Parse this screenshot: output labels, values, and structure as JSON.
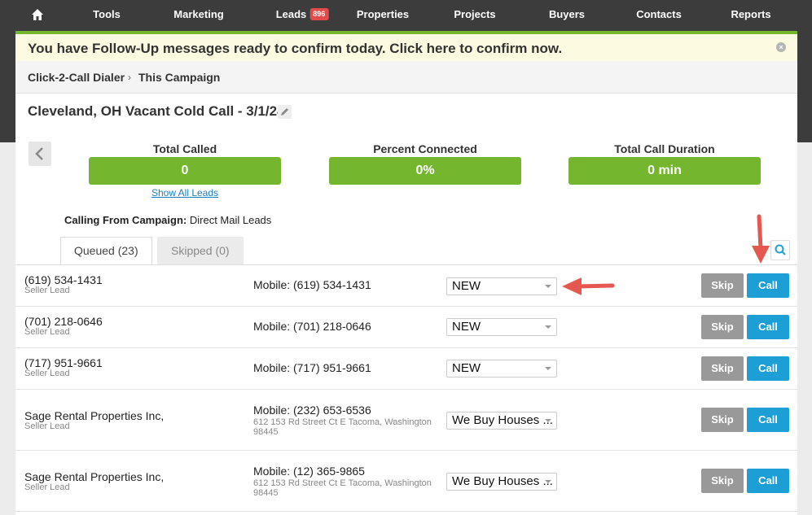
{
  "nav": {
    "home_icon": "home-icon",
    "items": [
      "Tools",
      "Marketing",
      "Leads",
      "Properties",
      "Projects",
      "Buyers",
      "Contacts",
      "Reports"
    ],
    "leads_badge": "896",
    "badge_color": "#e24b4b"
  },
  "alert": {
    "text": "You have Follow-Up messages ready to confirm today. Click here to confirm now.",
    "close_icon": "close-icon"
  },
  "breadcrumb": {
    "parent": "Click-2-Call Dialer",
    "separator": "›",
    "current": "This Campaign"
  },
  "campaign": {
    "title": "Cleveland, OH Vacant Cold Call - 3/1/24",
    "edit_icon": "pencil-icon"
  },
  "stats": {
    "total_called_label": "Total Called",
    "total_called_value": "0",
    "percent_connected_label": "Percent Connected",
    "percent_connected_value": "0%",
    "total_duration_label": "Total Call Duration",
    "total_duration_value": "0 min",
    "show_all_link": "Show All Leads",
    "stat_color": "#74b72e"
  },
  "calling_from": {
    "label": "Calling From Campaign:",
    "value": "Direct Mail Leads"
  },
  "tabs": {
    "queued": "Queued (23)",
    "skipped": "Skipped (0)"
  },
  "actions": {
    "skip_label": "Skip",
    "call_label": "Call",
    "call_color": "#1d9fd6"
  },
  "leads": [
    {
      "name": "(619) 534-1431",
      "type": "Seller Lead",
      "phone": "Mobile: (619) 534-1431",
      "address_line1": "",
      "address_line2": "",
      "status": "NEW"
    },
    {
      "name": "(701) 218-0646",
      "type": "Seller Lead",
      "phone": "Mobile: (701) 218-0646",
      "address_line1": "",
      "address_line2": "",
      "status": "NEW"
    },
    {
      "name": "(717) 951-9661",
      "type": "Seller Lead",
      "phone": "Mobile: (717) 951-9661",
      "address_line1": "",
      "address_line2": "",
      "status": "NEW"
    },
    {
      "name": "Sage Rental Properties Inc,",
      "type": "Seller Lead",
      "phone": "Mobile: (232) 653-6536",
      "address_line1": "612 153 Rd Street Ct E Tacoma, Washington",
      "address_line2": "98445",
      "status": "We Buy Houses ..."
    },
    {
      "name": "Sage Rental Properties Inc,",
      "type": "Seller Lead",
      "phone": "Mobile: (12) 365-9865",
      "address_line1": "612 153 Rd Street Ct E Tacoma, Washington",
      "address_line2": "98445",
      "status": "We Buy Houses ..."
    }
  ]
}
